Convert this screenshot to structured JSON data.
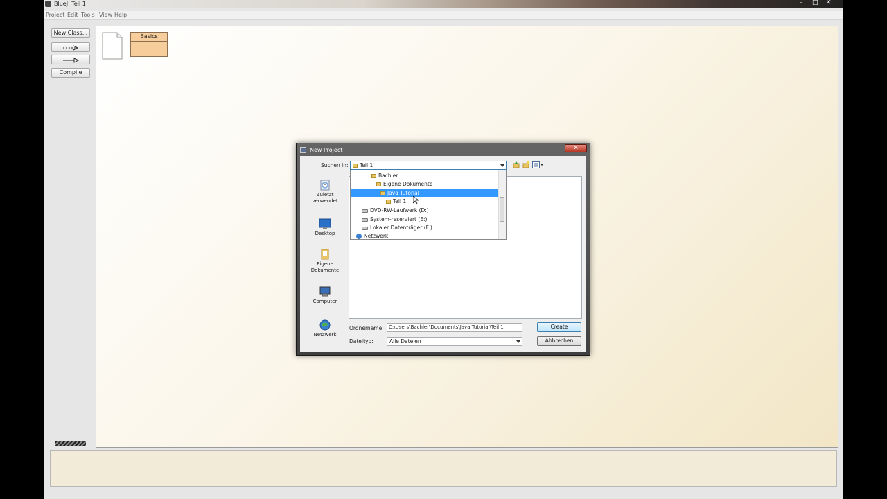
{
  "window": {
    "title": "BlueJ:  Teil 1",
    "controls": [
      "–",
      "□",
      "✕"
    ]
  },
  "menu": [
    "Project",
    "Edit",
    "Tools",
    "View",
    "Help"
  ],
  "toolbar": {
    "new_class": "New Class...",
    "compile": "Compile"
  },
  "canvas": {
    "classes": [
      {
        "name": "Basics"
      }
    ]
  },
  "dialog": {
    "title": "New Project",
    "close": "✕",
    "look_in_label": "Suchen in:",
    "look_in_value": "Teil 1",
    "places": [
      {
        "label": "Zuletzt verwendet",
        "icon": "recent-places-icon"
      },
      {
        "label": "Desktop",
        "icon": "desktop-icon"
      },
      {
        "label": "Eigene Dokumente",
        "icon": "my-documents-icon"
      },
      {
        "label": "Computer",
        "icon": "computer-icon"
      },
      {
        "label": "Netzwerk",
        "icon": "network-icon"
      }
    ],
    "dropdown_items": [
      {
        "label": "Bachler",
        "type": "folder"
      },
      {
        "label": "Eigene Dokumente",
        "type": "folder"
      },
      {
        "label": "Java Tutorial",
        "type": "folder",
        "selected": true
      },
      {
        "label": "Teil 1",
        "type": "folder"
      },
      {
        "label": "DVD-RW-Laufwerk (D:)",
        "type": "dvd"
      },
      {
        "label": "System-reserviert (E:)",
        "type": "drive"
      },
      {
        "label": "Lokaler Datenträger (F:)",
        "type": "drive"
      },
      {
        "label": "Netzwerk",
        "type": "network"
      }
    ],
    "folder_name_label": "Ordnername:",
    "folder_name_value": "C:\\Users\\Bachler\\Documents\\Java Tutorial\\Teil 1",
    "file_type_label": "Dateityp:",
    "file_type_value": "Alle Dateien",
    "create_button": "Create",
    "cancel_button": "Abbrechen"
  },
  "colors": {
    "class_box": "#f7cd9c",
    "selection": "#3399ff",
    "canvas": "#fbf6ea"
  }
}
